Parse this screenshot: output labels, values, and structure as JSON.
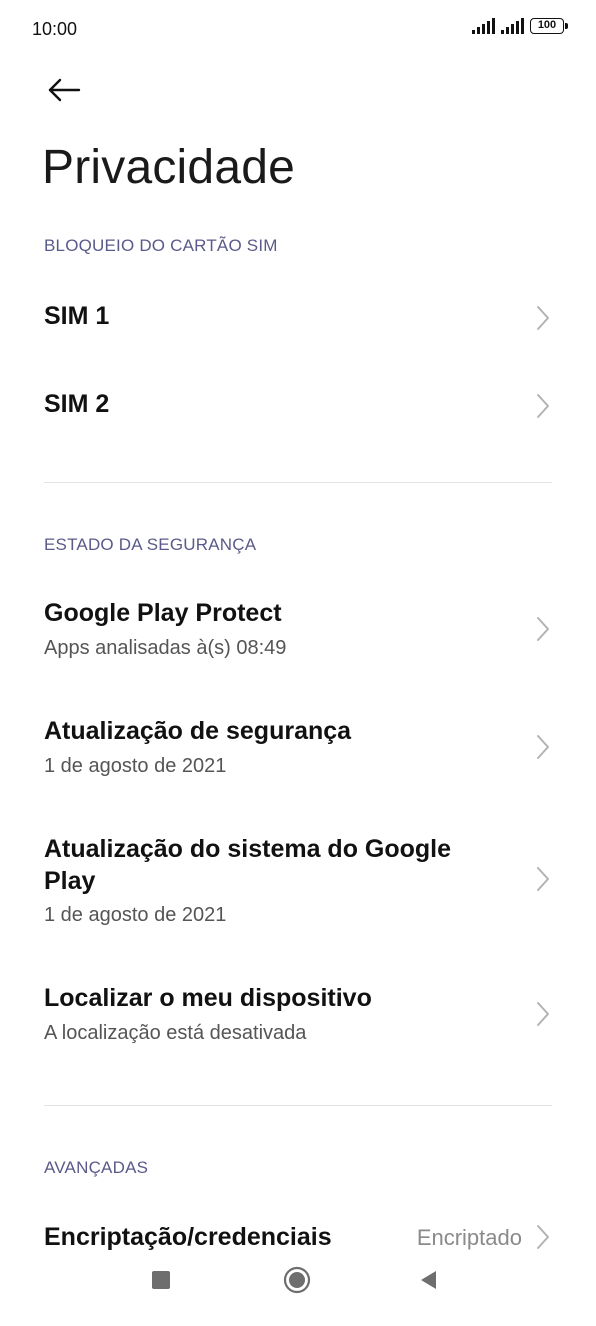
{
  "status_bar": {
    "time": "10:00",
    "battery": "100",
    "signal_icon": "signal-icon",
    "battery_icon": "battery-icon"
  },
  "header": {
    "back_icon": "arrow-left-icon",
    "title": "Privacidade"
  },
  "sections": {
    "sim_lock": {
      "header": "BLOQUEIO DO CARTÃO SIM",
      "items": [
        {
          "title": "SIM 1"
        },
        {
          "title": "SIM 2"
        }
      ]
    },
    "security_status": {
      "header": "ESTADO DA SEGURANÇA",
      "items": [
        {
          "title": "Google Play Protect",
          "subtitle": "Apps analisadas à(s) 08:49"
        },
        {
          "title": "Atualização de segurança",
          "subtitle": "1 de agosto de 2021"
        },
        {
          "title_line1": "Atualização do sistema do Google",
          "title_line2": "Play",
          "subtitle": "1 de agosto de 2021"
        },
        {
          "title": "Localizar o meu dispositivo",
          "subtitle": "A localização está desativada"
        }
      ]
    },
    "advanced": {
      "header": "AVANÇADAS",
      "items": [
        {
          "title": "Encriptação/credenciais",
          "value": "Encriptado"
        }
      ]
    }
  },
  "nav_bar": {
    "recents_icon": "square-icon",
    "home_icon": "circle-icon",
    "back_icon": "triangle-back-icon"
  },
  "colors": {
    "section_header": "#5a5a8a",
    "chevron": "#b3b3b3",
    "divider": "#e3e3e3"
  }
}
